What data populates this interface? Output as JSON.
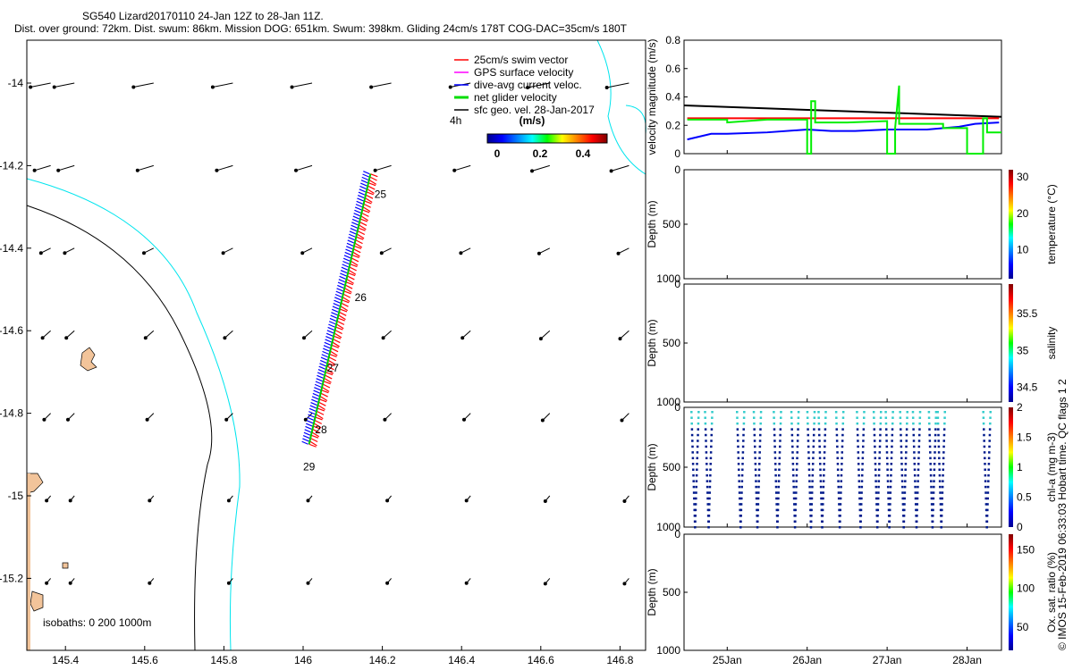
{
  "title": {
    "line1": "SG540 Lizard20170110 24-Jan 12Z to 28-Jan 11Z.",
    "line2": "Dist. over ground: 72km. Dist. swum: 86km. Mission DOG: 651km. Swum: 398km. Gliding 24cm/s 178T COG-DAC=35cm/s 180T"
  },
  "copyright": "© IMOS 15-Feb-2019 06:33:03 Hobart time. QC flags 1  2",
  "chart_data": [
    {
      "type": "map",
      "name": "track-map",
      "xticks": [
        145.4,
        145.6,
        145.8,
        146,
        146.2,
        146.4,
        146.6,
        146.8
      ],
      "xtick_labels": [
        "145.4",
        "145.6",
        "145.8",
        "146",
        "146.2",
        "146.4",
        "146.6",
        "146.8"
      ],
      "yticks": [
        -14,
        -14.2,
        -14.4,
        -14.6,
        -14.8,
        -15,
        -15.2
      ],
      "ytick_labels": [
        "-14",
        "-14.2",
        "-14.4",
        "-14.6",
        "-14.8",
        "-15",
        "-15.2"
      ],
      "xlim": [
        145.3,
        146.85
      ],
      "ylim": [
        -15.38,
        -13.9
      ],
      "legend": [
        "25cm/s swim vector",
        "GPS surface velocity",
        "dive-avg current veloc.",
        "net glider velocity",
        "sfc geo. vel. 28-Jan-2017"
      ],
      "legend_colors": [
        "#ff0000",
        "#ff00ff",
        "#0000ff",
        "#00dd00",
        "#000000"
      ],
      "scale_label": "4h",
      "colorbar_label": "(m/s)",
      "colorbar_ticks": [
        "0",
        "0.2",
        "0.4"
      ],
      "isobath_label": "isobaths: 0   200  1000m",
      "track": {
        "start": [
          146.17,
          -14.22
        ],
        "end": [
          146.015,
          -14.875
        ]
      },
      "day_labels": [
        {
          "t": "25",
          "lon": 146.18,
          "lat": -14.27
        },
        {
          "t": "26",
          "lon": 146.13,
          "lat": -14.52
        },
        {
          "t": "27",
          "lon": 146.06,
          "lat": -14.69
        },
        {
          "t": "28",
          "lon": 146.03,
          "lat": -14.84
        },
        {
          "t": "29",
          "lon": 146.0,
          "lat": -14.93
        }
      ],
      "geo_vel_lats": [
        -14,
        -14.2,
        -14.4,
        -14.6,
        -14.8,
        -15,
        -15.2
      ],
      "geo_vel_lons": [
        145.34,
        145.4,
        145.6,
        145.8,
        146,
        146.2,
        146.4,
        146.6,
        146.8
      ],
      "geo_vel_uv": [
        [
          -0.25,
          -0.05
        ],
        [
          -0.2,
          -0.06
        ],
        [
          -0.12,
          -0.06
        ],
        [
          -0.1,
          -0.09
        ],
        [
          -0.08,
          -0.08
        ],
        [
          -0.05,
          -0.06
        ]
      ]
    },
    {
      "type": "line",
      "name": "velocity-magnitude",
      "ylabel": "velocity magnitude (m/s)",
      "ylim": [
        0,
        0.8
      ],
      "yticks": [
        "0",
        "0.2",
        "0.4",
        "0.6",
        "0.8"
      ],
      "xlim": [
        24.46,
        28.43
      ],
      "series": [
        {
          "name": "sfc geo",
          "color": "#000000",
          "x": [
            24.46,
            28.43
          ],
          "y": [
            0.34,
            0.26
          ]
        },
        {
          "name": "swim",
          "color": "#ff0000",
          "x": [
            24.5,
            28.4
          ],
          "y": [
            0.25,
            0.25
          ]
        },
        {
          "name": "dive-avg",
          "color": "#0000ff",
          "x": [
            24.5,
            24.8,
            25.0,
            25.5,
            26.0,
            26.3,
            26.6,
            27.0,
            27.5,
            27.9,
            28.1,
            28.4
          ],
          "y": [
            0.1,
            0.14,
            0.14,
            0.15,
            0.17,
            0.16,
            0.16,
            0.17,
            0.17,
            0.19,
            0.21,
            0.22
          ]
        },
        {
          "name": "net glider",
          "color": "#00ee00",
          "x": [
            24.5,
            25.0,
            25.0,
            25.5,
            25.9,
            26.0,
            26.0,
            26.05,
            26.05,
            26.1,
            26.1,
            26.5,
            27.0,
            27.0,
            27.1,
            27.1,
            27.15,
            27.15,
            27.7,
            27.7,
            28.0,
            28.0,
            28.2,
            28.2,
            28.25,
            28.25,
            28.43
          ],
          "y": [
            0.24,
            0.24,
            0.22,
            0.24,
            0.24,
            0.24,
            0,
            0,
            0.37,
            0.37,
            0.22,
            0.22,
            0.23,
            0,
            0,
            0.18,
            0.48,
            0.21,
            0.21,
            0.18,
            0.18,
            0,
            0,
            0.25,
            0.25,
            0.15,
            0.15
          ]
        }
      ]
    },
    {
      "type": "scatter",
      "name": "temperature-section",
      "ylabel": "Depth (m)",
      "yticks": [
        "0",
        "500",
        "1000"
      ],
      "cbar_label": "temperature (°C)",
      "cbar_ticks": [
        "10",
        "20",
        "30"
      ],
      "cbar_range": [
        2,
        32
      ]
    },
    {
      "type": "scatter",
      "name": "salinity-section",
      "ylabel": "Depth (m)",
      "yticks": [
        "0",
        "500",
        "1000"
      ],
      "cbar_label": "salinity",
      "cbar_ticks": [
        "34.5",
        "35",
        "35.5"
      ],
      "cbar_range": [
        34.3,
        35.9
      ]
    },
    {
      "type": "scatter",
      "name": "chla-section",
      "ylabel": "Depth (m)",
      "yticks": [
        "0",
        "500",
        "1000"
      ],
      "cbar_label": "chl-a (mg m-3)",
      "cbar_ticks": [
        "0",
        "0.5",
        "1",
        "1.5",
        "2"
      ],
      "cbar_range": [
        0,
        2
      ],
      "dive_times": [
        24.55,
        24.72,
        25.12,
        25.33,
        25.58,
        25.8,
        26.0,
        26.14,
        26.36,
        26.62,
        26.83,
        26.98,
        27.16,
        27.32,
        27.52,
        27.63,
        28.2
      ],
      "max_depth": 1000
    },
    {
      "type": "scatter",
      "name": "oxygen-section",
      "ylabel": "Depth (m)",
      "yticks": [
        "0",
        "500",
        "1000"
      ],
      "cbar_label": "Ox. sat. ratio (%)",
      "cbar_ticks": [
        "50",
        "100",
        "150"
      ],
      "cbar_range": [
        20,
        170
      ]
    },
    {
      "xticks": [
        25,
        26,
        27,
        28
      ],
      "xtick_labels": [
        "25Jan",
        "26Jan",
        "27Jan",
        "28Jan"
      ]
    }
  ]
}
